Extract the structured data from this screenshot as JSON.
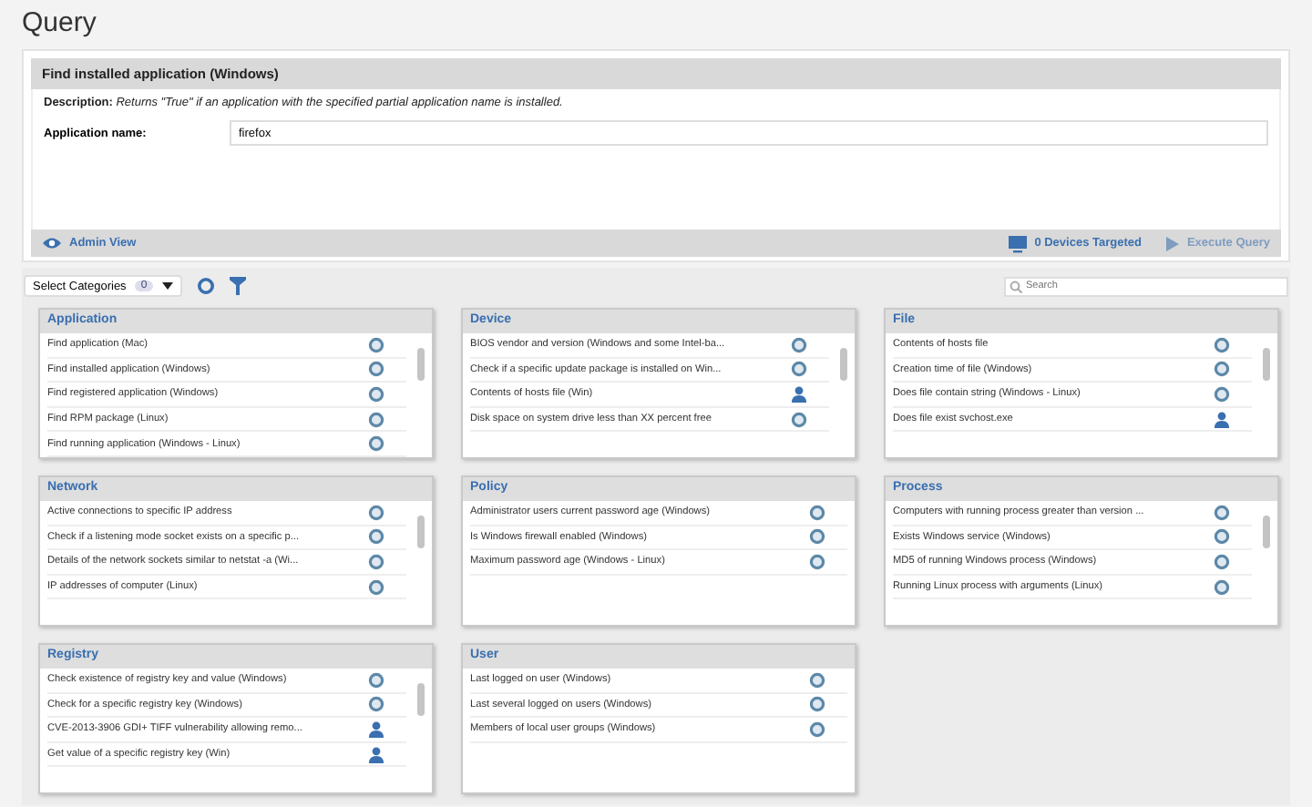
{
  "page_title": "Query",
  "query": {
    "title": "Find installed application (Windows)",
    "description_label": "Description:",
    "description": "Returns \"True\" if an application with the specified partial application name is installed.",
    "field_label": "Application name:",
    "field_value": "firefox"
  },
  "action_bar": {
    "admin_view": "Admin View",
    "devices_targeted": "0 Devices Targeted",
    "execute": {
      "label": "Execute Query",
      "disabled": true
    }
  },
  "toolbar": {
    "select_categories": "Select Categories",
    "category_count": "0",
    "search": {
      "placeholder": "Search"
    }
  },
  "panels": [
    {
      "title": "Application",
      "scrollable": true,
      "items": [
        {
          "label": "Find application (Mac)",
          "kind": "system"
        },
        {
          "label": "Find installed application (Windows)",
          "kind": "system"
        },
        {
          "label": "Find registered application (Windows)",
          "kind": "system"
        },
        {
          "label": "Find RPM package (Linux)",
          "kind": "system"
        },
        {
          "label": "Find running application (Windows - Linux)",
          "kind": "system"
        }
      ]
    },
    {
      "title": "Device",
      "scrollable": true,
      "items": [
        {
          "label": "BIOS vendor and version (Windows and some Intel-ba...",
          "kind": "system"
        },
        {
          "label": "Check if a specific update package is installed on Win...",
          "kind": "system"
        },
        {
          "label": "Contents of hosts file (Win)",
          "kind": "user"
        },
        {
          "label": "Disk space on system drive less than XX percent free",
          "kind": "system"
        }
      ]
    },
    {
      "title": "File",
      "scrollable": true,
      "items": [
        {
          "label": "Contents of hosts file",
          "kind": "system"
        },
        {
          "label": "Creation time of file (Windows)",
          "kind": "system"
        },
        {
          "label": "Does file contain string (Windows - Linux)",
          "kind": "system"
        },
        {
          "label": "Does file exist svchost.exe",
          "kind": "user"
        }
      ]
    },
    {
      "title": "Network",
      "scrollable": true,
      "items": [
        {
          "label": "Active connections to specific IP address",
          "kind": "system"
        },
        {
          "label": "Check if a listening mode socket exists on a specific p...",
          "kind": "system"
        },
        {
          "label": "Details of the network sockets similar to netstat -a (Wi...",
          "kind": "system"
        },
        {
          "label": "IP addresses of computer (Linux)",
          "kind": "system"
        }
      ]
    },
    {
      "title": "Policy",
      "scrollable": false,
      "items": [
        {
          "label": "Administrator users current password age (Windows)",
          "kind": "system"
        },
        {
          "label": "Is Windows firewall enabled (Windows)",
          "kind": "system"
        },
        {
          "label": "Maximum password age (Windows - Linux)",
          "kind": "system"
        }
      ]
    },
    {
      "title": "Process",
      "scrollable": true,
      "items": [
        {
          "label": "Computers with running process greater than version ...",
          "kind": "system"
        },
        {
          "label": "Exists Windows service (Windows)",
          "kind": "system"
        },
        {
          "label": "MD5 of running Windows process (Windows)",
          "kind": "system"
        },
        {
          "label": "Running Linux process with arguments (Linux)",
          "kind": "system"
        }
      ]
    },
    {
      "title": "Registry",
      "scrollable": true,
      "items": [
        {
          "label": "Check existence of registry key and value (Windows)",
          "kind": "system"
        },
        {
          "label": "Check for a specific registry key (Windows)",
          "kind": "system"
        },
        {
          "label": "CVE-2013-3906 GDI+ TIFF vulnerability allowing remo...",
          "kind": "user"
        },
        {
          "label": "Get value of a specific registry key (Win)",
          "kind": "user"
        }
      ]
    },
    {
      "title": "User",
      "scrollable": false,
      "items": [
        {
          "label": "Last logged on user (Windows)",
          "kind": "system"
        },
        {
          "label": "Last several logged on users (Windows)",
          "kind": "system"
        },
        {
          "label": "Members of local user groups (Windows)",
          "kind": "system"
        }
      ]
    }
  ]
}
